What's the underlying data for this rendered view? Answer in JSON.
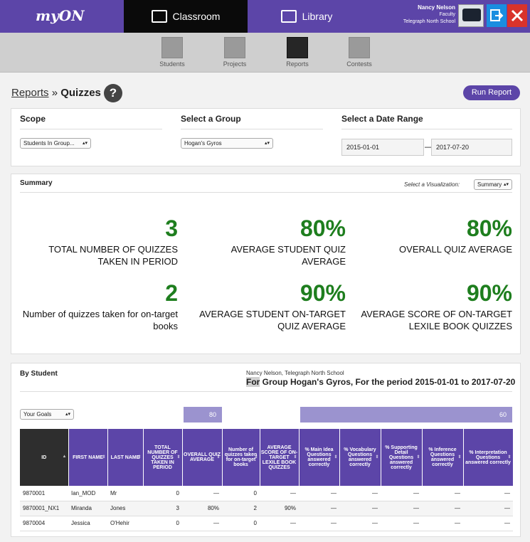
{
  "brand": {
    "logo": "myON"
  },
  "nav": {
    "classroom": "Classroom",
    "library": "Library"
  },
  "user": {
    "name": "Nancy Nelson",
    "role": "Faculty",
    "school": "Telegraph North School"
  },
  "subnav": [
    {
      "label": "Students",
      "icon": "students-icon"
    },
    {
      "label": "Projects",
      "icon": "projects-icon"
    },
    {
      "label": "Reports",
      "icon": "reports-icon",
      "active": true
    },
    {
      "label": "Contests",
      "icon": "trophy-icon"
    }
  ],
  "breadcrumb": {
    "parent": "Reports",
    "separator": "»",
    "current": "Quizzes",
    "help": "?"
  },
  "run_report": "Run Report",
  "filters": {
    "scope_label": "Scope",
    "scope_value": "Students In Group...",
    "group_label": "Select a Group",
    "group_value": "Hogan's Gyros",
    "date_label": "Select a Date Range",
    "date_from": "2015-01-01",
    "date_to": "2017-07-20",
    "date_sep": "—"
  },
  "summary": {
    "title": "Summary",
    "viz_label": "Select a Visualization:",
    "viz_value": "Summary",
    "stats": [
      {
        "value": "3",
        "label": "TOTAL NUMBER OF QUIZZES TAKEN IN PERIOD"
      },
      {
        "value": "80%",
        "label": "AVERAGE STUDENT QUIZ AVERAGE"
      },
      {
        "value": "80%",
        "label": "OVERALL QUIZ AVERAGE"
      },
      {
        "value": "2",
        "label": "Number of quizzes taken for on-target books"
      },
      {
        "value": "90%",
        "label": "AVERAGE STUDENT ON-TARGET QUIZ AVERAGE"
      },
      {
        "value": "90%",
        "label": "AVERAGE SCORE OF ON-TARGET LEXILE BOOK QUIZZES"
      }
    ]
  },
  "by_student": {
    "title": "By Student",
    "school_line": "Nancy Nelson, Telegraph North School",
    "for_word": "For",
    "for_rest": " Group Hogan's Gyros, For the period 2015-01-01 to 2017-07-20",
    "goals_value": "Your Goals",
    "goal_overall": "80",
    "goal_interp": "60"
  },
  "table": {
    "headers": [
      "ID",
      "FIRST NAME",
      "LAST NAME",
      "TOTAL NUMBER OF QUIZZES TAKEN IN PERIOD",
      "OVERALL QUIZ AVERAGE",
      "Number of quizzes taken for on-target books",
      "AVERAGE SCORE OF ON-TARGET LEXILE BOOK QUIZZES",
      "% Main Idea Questions answered correctly",
      "% Vocabulary Questions answered correctly",
      "% Supporting Detail Questions answered correctly",
      "% Inference Questions answered correctly",
      "% Interpretation Questions answered correctly"
    ],
    "rows": [
      [
        "9870001",
        "Ian_MOD",
        "Mr",
        "0",
        "—",
        "0",
        "—",
        "—",
        "—",
        "—",
        "—",
        "—"
      ],
      [
        "9870001_NX1",
        "Miranda",
        "Jones",
        "3",
        "80%",
        "2",
        "90%",
        "—",
        "—",
        "—",
        "—",
        "—"
      ],
      [
        "9870004",
        "Jessica",
        "O'Hehir",
        "0",
        "—",
        "0",
        "—",
        "—",
        "—",
        "—",
        "—",
        "—"
      ]
    ]
  }
}
